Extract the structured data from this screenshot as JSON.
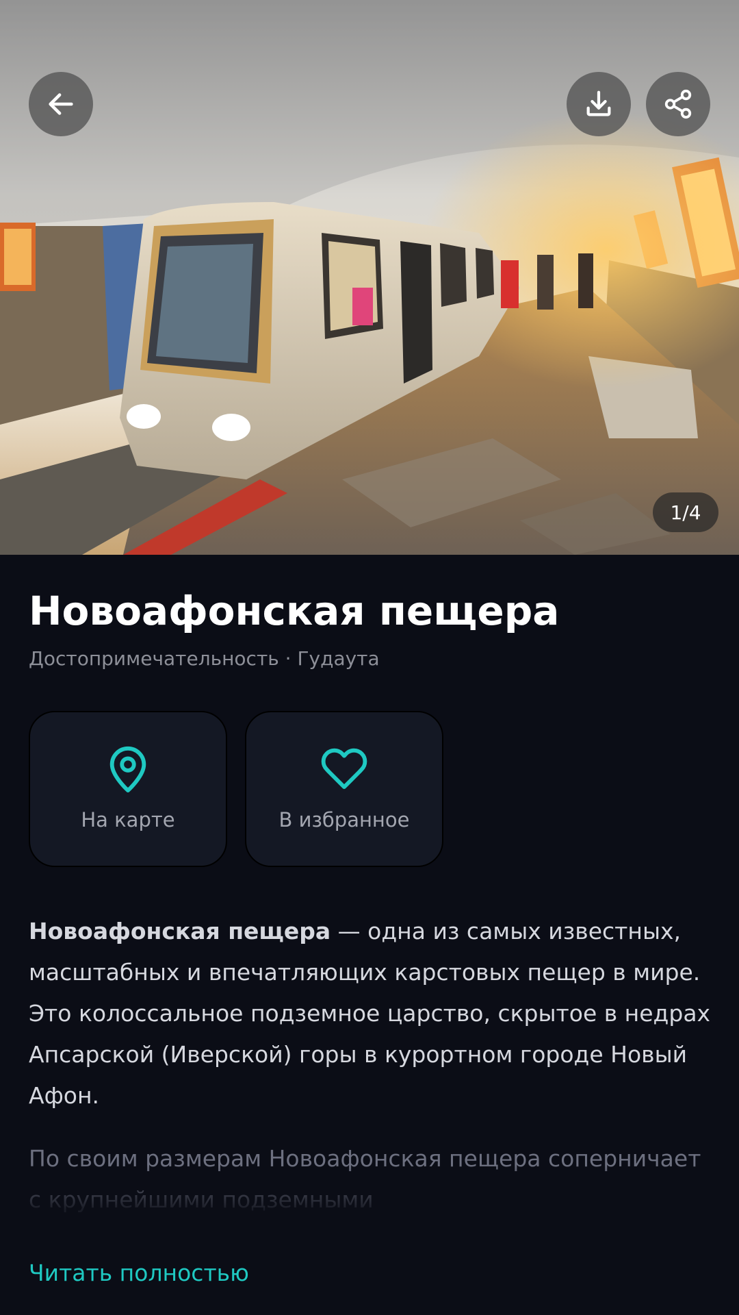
{
  "header": {
    "back_icon": "arrow-left-icon",
    "download_icon": "download-icon",
    "share_icon": "share-icon",
    "photo_counter": "1/4"
  },
  "place": {
    "title": "Новоафонская пещера",
    "subtitle": "Достопримечательность · Гудаута"
  },
  "actions": {
    "map_label": "На карте",
    "map_icon": "map-pin-icon",
    "favorite_label": "В избранное",
    "favorite_icon": "heart-icon"
  },
  "description": {
    "bold_lead": "Новоафонская пещера",
    "paragraph1_rest": " — одна из самых известных, масштабных и впечатляющих карстовых пещер в мире. Это колоссальное подземное царство, скрытое в недрах Апсарской (Иверской) горы в курортном городе Новый Афон.",
    "paragraph2": "По своим размерам Новоафонская пещера соперничает с крупнейшими подземными",
    "read_more": "Читать полностью"
  },
  "colors": {
    "accent": "#1fc9c2",
    "background": "#0b0d16",
    "card": "#141824"
  }
}
